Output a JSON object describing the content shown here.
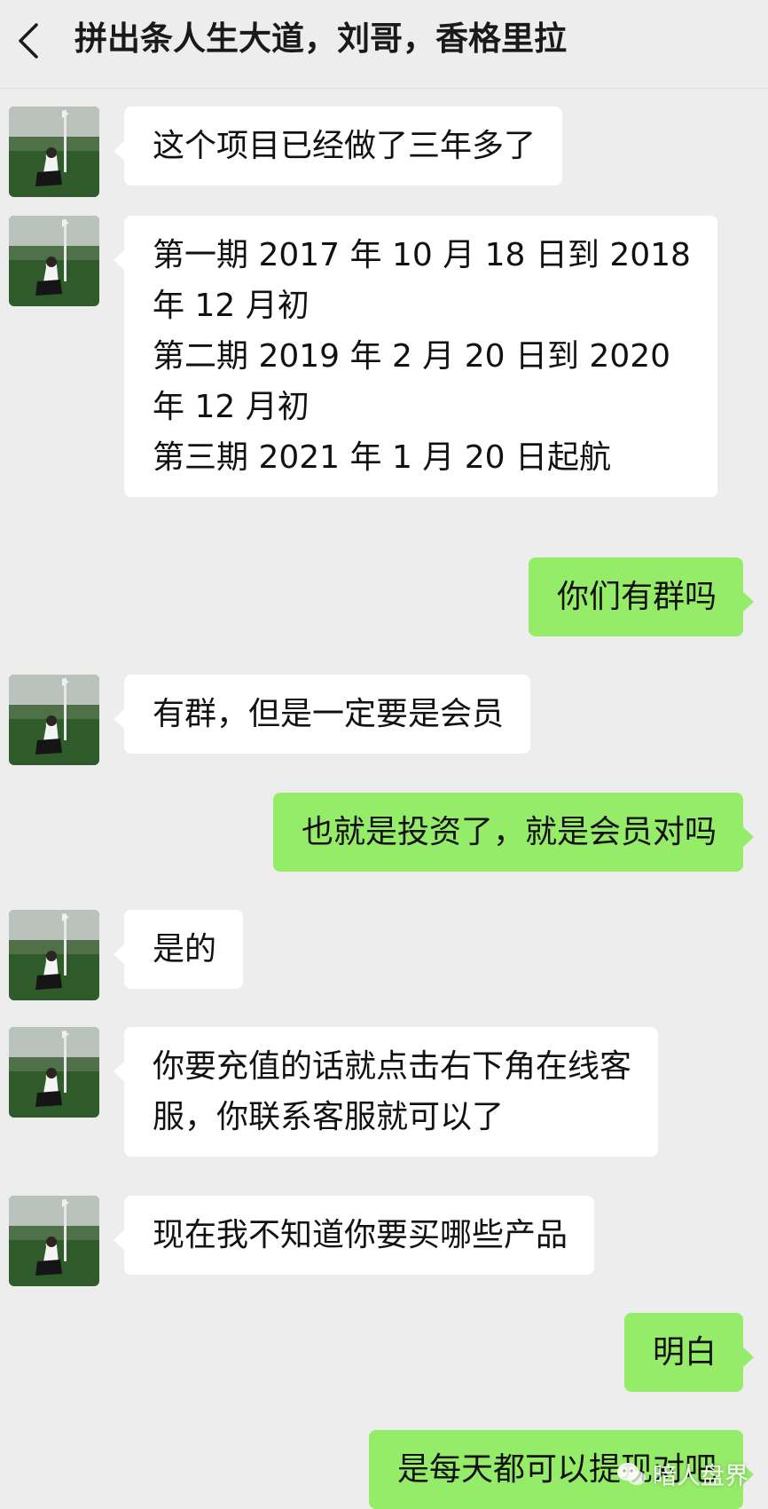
{
  "header": {
    "title": "拼出条人生大道，刘哥，香格里拉",
    "back_icon": "chevron-left-icon"
  },
  "colors": {
    "background": "#ededed",
    "incoming_bubble": "#ffffff",
    "outgoing_bubble": "#95ec69"
  },
  "messages": [
    {
      "from": "contact",
      "lines": [
        "这个项目已经做了三年多了"
      ]
    },
    {
      "from": "contact",
      "lines": [
        "第一期 2017 年 10 月 18 日到 2018",
        "年 12 月初",
        "第二期 2019 年 2 月 20 日到 2020",
        "年 12 月初",
        "第三期 2021 年 1 月 20 日起航"
      ]
    },
    {
      "from": "me",
      "lines": [
        "你们有群吗"
      ]
    },
    {
      "from": "contact",
      "lines": [
        "有群，但是一定要是会员"
      ]
    },
    {
      "from": "me",
      "lines": [
        "也就是投资了，就是会员对吗"
      ]
    },
    {
      "from": "contact",
      "lines": [
        "是的"
      ]
    },
    {
      "from": "contact",
      "lines": [
        "你要充值的话就点击右下角在线客",
        "服，你联系客服就可以了"
      ]
    },
    {
      "from": "contact",
      "lines": [
        "现在我不知道你要买哪些产品"
      ]
    },
    {
      "from": "me",
      "lines": [
        "明白"
      ]
    },
    {
      "from": "me",
      "lines": [
        "是每天都可以提现对吧"
      ]
    }
  ],
  "watermark": {
    "text": "暗人盘界",
    "icon": "wechat-official-account-icon"
  }
}
